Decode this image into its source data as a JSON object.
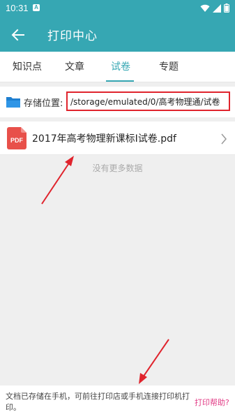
{
  "status_bar": {
    "time": "10:31",
    "app_icon": "A",
    "icons": [
      "wifi-icon",
      "signal-icon",
      "battery-icon"
    ]
  },
  "app_bar": {
    "title": "打印中心",
    "back_icon": "arrow-left-icon"
  },
  "tabs": [
    {
      "label": "知识点",
      "active": false
    },
    {
      "label": "文章",
      "active": false
    },
    {
      "label": "试卷",
      "active": true
    },
    {
      "label": "专题",
      "active": false
    }
  ],
  "storage": {
    "label": "存储位置:",
    "path": "/storage/emulated/0/高考物理通/试卷"
  },
  "files": [
    {
      "icon_text": "PDF",
      "name": "2017年高考物理新课标I试卷.pdf"
    }
  ],
  "empty_message": "没有更多数据",
  "footer": {
    "text": "文档已存储在手机，可前往打印店或手机连接打印机打印。",
    "help_link": "打印帮助?"
  },
  "colors": {
    "primary": "#36a7b3",
    "highlight_box": "#e0242d",
    "pdf_red": "#e8504a",
    "help_link": "#e23c86"
  }
}
